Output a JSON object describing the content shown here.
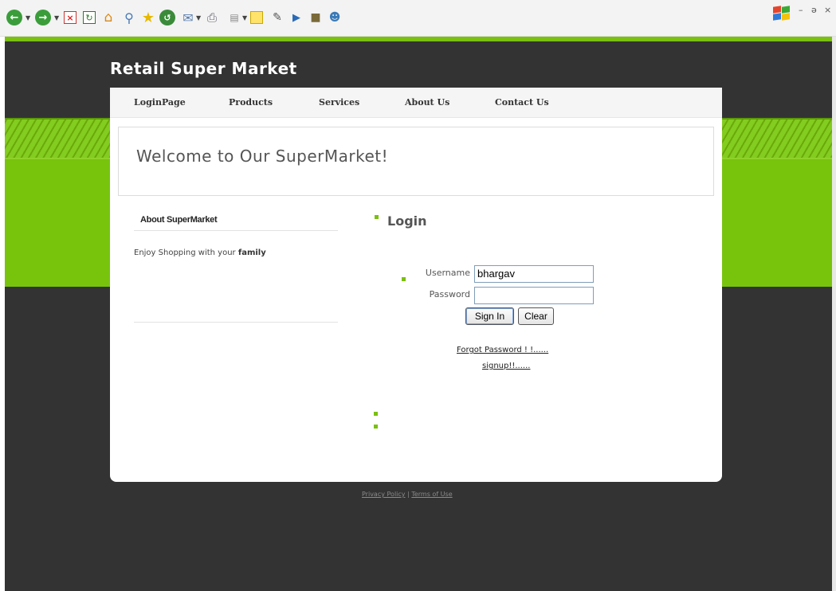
{
  "browser": {
    "toolbar_icons": [
      "back-icon",
      "forward-icon",
      "stop-icon",
      "refresh-icon",
      "home-icon",
      "search-icon",
      "favorites-icon",
      "history-icon",
      "mail-icon",
      "print-icon",
      "edit-icon",
      "note-icon",
      "messenger-icon",
      "research-icon",
      "media-icon",
      "contacts-icon"
    ],
    "window_controls": {
      "minimize": "–",
      "restore": "ǝ",
      "close": "×"
    }
  },
  "site": {
    "title": "Retail Super Market",
    "nav": [
      "LoginPage",
      "Products",
      "Services",
      "About Us",
      "Contact Us"
    ],
    "welcome": "Welcome to Our SuperMarket!"
  },
  "sidebar": {
    "title": "About SuperMarket",
    "text_prefix": "Enjoy Shopping with your ",
    "text_bold": "family"
  },
  "login": {
    "title": "Login",
    "username_label": "Username",
    "username_value": "bhargav",
    "password_label": "Password",
    "password_value": "",
    "sign_in": "Sign In",
    "clear": "Clear",
    "forgot": "Forgot Password ! !......",
    "signup": "signup!!......"
  },
  "footer": {
    "privacy": "Privacy Policy",
    "separator": "|",
    "terms": "Terms of Use"
  },
  "colors": {
    "accent_green": "#78c40d",
    "background_dark": "#333333"
  }
}
